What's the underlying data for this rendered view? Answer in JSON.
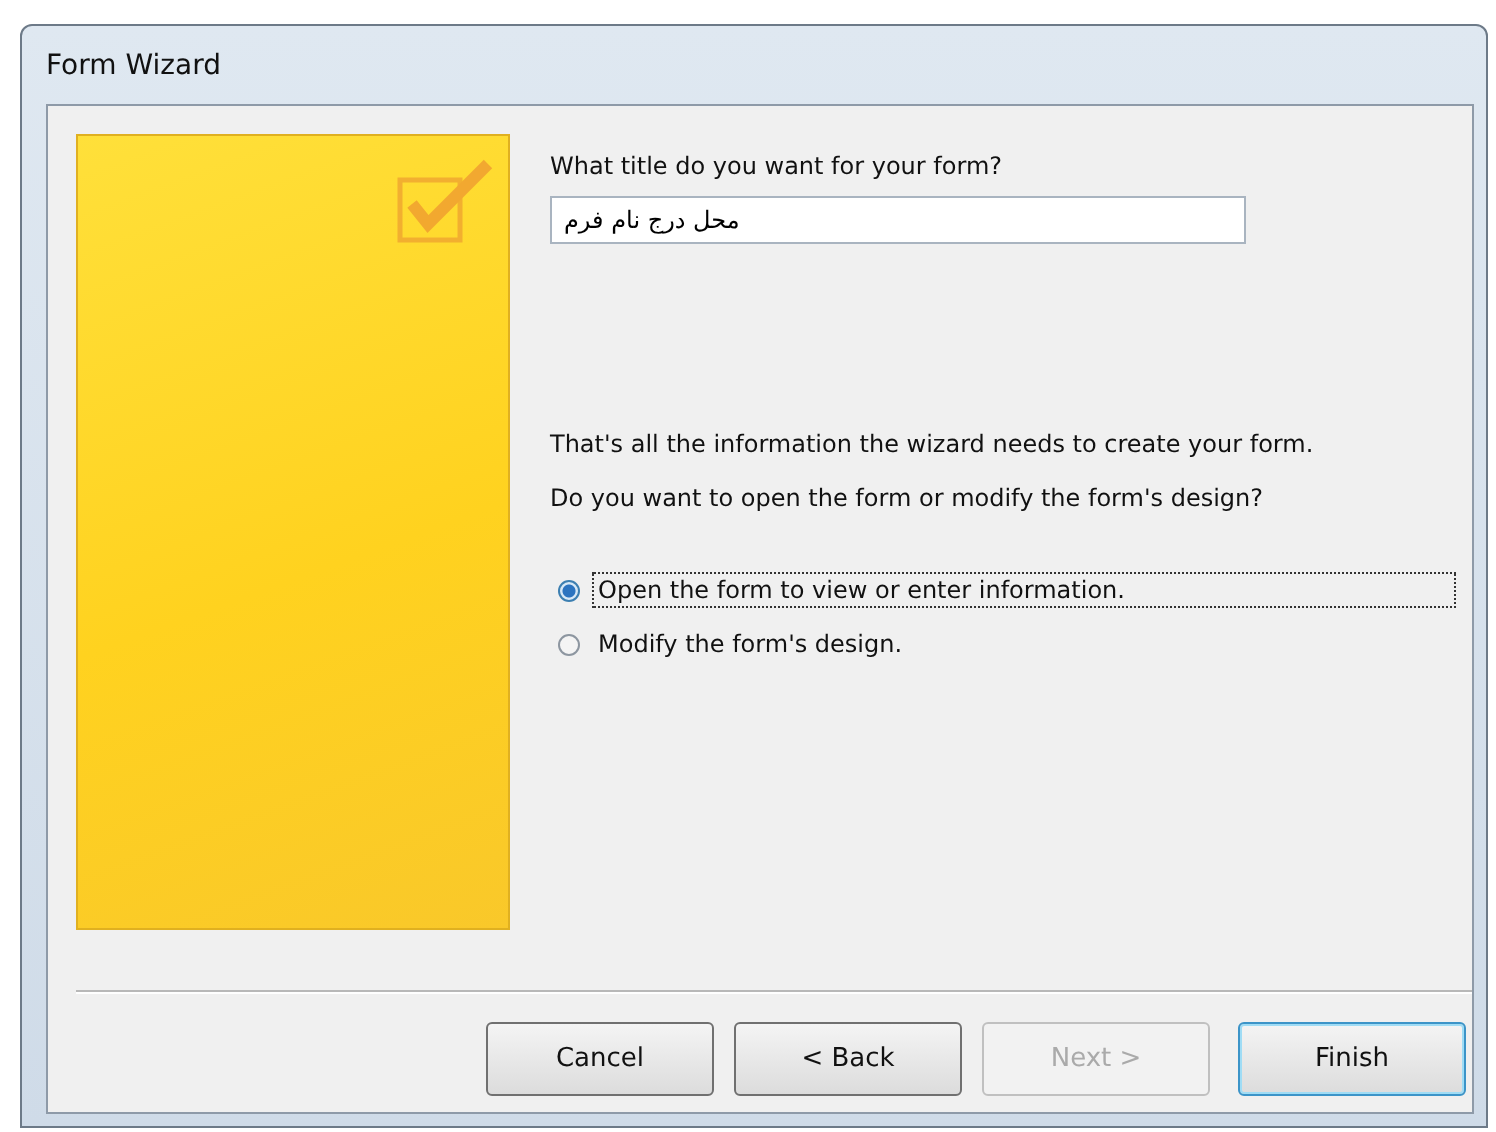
{
  "window": {
    "title": "Form Wizard"
  },
  "title_prompt": "What title do you want for your form?",
  "title_field": {
    "value": "محل درج نام فرم"
  },
  "info_text": "That's all the information the wizard needs to create your form.",
  "question": "Do you want to open the form or modify the form's design?",
  "options": [
    {
      "label": "Open the form to view or enter information.",
      "selected": true
    },
    {
      "label": "Modify the form's design.",
      "selected": false
    }
  ],
  "buttons": [
    {
      "label": "Cancel",
      "disabled": false,
      "default": false
    },
    {
      "label": "< Back",
      "disabled": false,
      "default": false
    },
    {
      "label": "Next >",
      "disabled": true,
      "default": false
    },
    {
      "label": "Finish",
      "disabled": false,
      "default": true
    }
  ]
}
